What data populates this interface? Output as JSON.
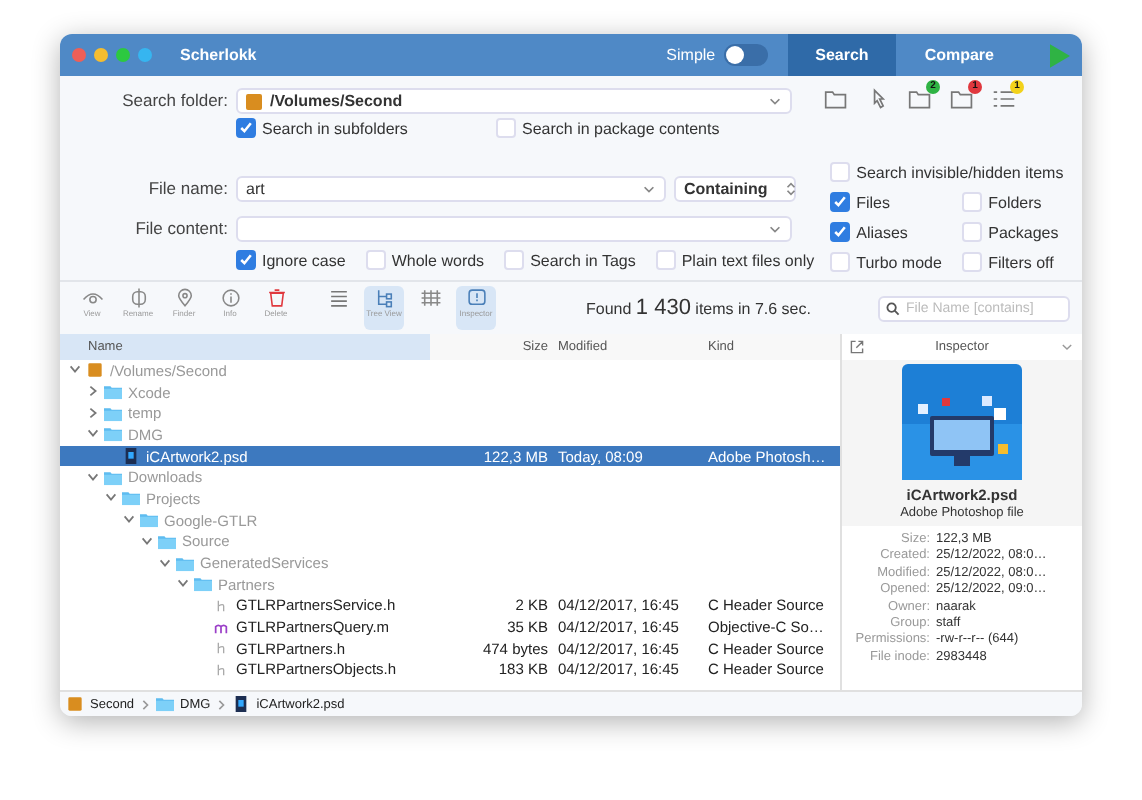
{
  "window": {
    "title": "Scherlokk"
  },
  "mode_toggle": {
    "label": "Simple",
    "on": false
  },
  "tabs": [
    {
      "label": "Search",
      "selected": true
    },
    {
      "label": "Compare",
      "selected": false
    }
  ],
  "folder_badges": [
    {
      "count": "2",
      "color": "#2fb344"
    },
    {
      "count": "1",
      "color": "#e0383e"
    },
    {
      "count": "1",
      "color": "#f2d21b"
    }
  ],
  "search_folder": {
    "label": "Search folder:",
    "value": "/Volumes/Second"
  },
  "folder_options": [
    {
      "label": "Search in subfolders",
      "checked": true
    },
    {
      "label": "Search in package contents",
      "checked": false
    }
  ],
  "file_name": {
    "label": "File name:",
    "value": "art",
    "match": "Containing"
  },
  "file_content": {
    "label": "File content:"
  },
  "content_options": [
    {
      "label": "Ignore case",
      "checked": true
    },
    {
      "label": "Whole words",
      "checked": false
    },
    {
      "label": "Search in Tags",
      "checked": false
    },
    {
      "label": "Plain text files only",
      "checked": false
    }
  ],
  "hidden_option": {
    "label": "Search invisible/hidden items",
    "checked": false
  },
  "filter_options": [
    {
      "label": "Files",
      "checked": true
    },
    {
      "label": "Folders",
      "checked": false
    },
    {
      "label": "Aliases",
      "checked": true
    },
    {
      "label": "Packages",
      "checked": false
    },
    {
      "label": "Turbo mode",
      "checked": false
    },
    {
      "label": "Filters off",
      "checked": false
    }
  ],
  "toolbar": [
    {
      "kind": "view",
      "label": "View",
      "selected": false
    },
    {
      "kind": "rename",
      "label": "Rename",
      "selected": false
    },
    {
      "kind": "finder",
      "label": "Finder",
      "selected": false
    },
    {
      "kind": "info",
      "label": "Info",
      "selected": false
    },
    {
      "kind": "delete",
      "label": "Delete",
      "selected": false
    },
    {
      "kind": "list",
      "selected": false
    },
    {
      "kind": "tree",
      "label": "Tree View",
      "selected": true
    },
    {
      "kind": "grid",
      "selected": false
    },
    {
      "kind": "inspector",
      "label": "Inspector",
      "selected": true
    }
  ],
  "result": {
    "prefix": "Found",
    "count": "1 430",
    "suffix": "items in 7.6 sec."
  },
  "filter_field": {
    "placeholder": "File Name [contains]"
  },
  "table": {
    "columns": [
      "Name",
      "Size",
      "Modified",
      "Kind"
    ],
    "rows": [
      {
        "kind": "volume",
        "name": "/Volumes/Second",
        "expanded": true,
        "children": [
          {
            "kind": "folder",
            "name": "Xcode",
            "expanded": false
          },
          {
            "kind": "folder",
            "name": "temp",
            "expanded": false
          },
          {
            "kind": "folder",
            "name": "DMG",
            "expanded": true,
            "children": [
              {
                "kind": "psd",
                "name": "iCArtwork2.psd",
                "size": "122,3 MB",
                "modified": "Today, 08:09",
                "file_type": "Adobe Photosh…",
                "selected": true
              }
            ]
          },
          {
            "kind": "folder",
            "name": "Downloads",
            "expanded": true,
            "children": [
              {
                "kind": "folder",
                "name": "Projects",
                "expanded": true,
                "children": [
                  {
                    "kind": "folder",
                    "name": "Google-GTLR",
                    "expanded": true,
                    "children": [
                      {
                        "kind": "folder",
                        "name": "Source",
                        "expanded": true,
                        "children": [
                          {
                            "kind": "folder",
                            "name": "GeneratedServices",
                            "expanded": true,
                            "children": [
                              {
                                "kind": "folder",
                                "name": "Partners",
                                "expanded": true,
                                "children": [
                                  {
                                    "kind": "h",
                                    "name": "GTLRPartnersService.h",
                                    "size": "2 KB",
                                    "modified": "04/12/2017, 16:45",
                                    "file_type": "C Header Source",
                                    "selected": false
                                  },
                                  {
                                    "kind": "m",
                                    "name": "GTLRPartnersQuery.m",
                                    "size": "35 KB",
                                    "modified": "04/12/2017, 16:45",
                                    "file_type": "Objective-C So…",
                                    "selected": false
                                  },
                                  {
                                    "kind": "h",
                                    "name": "GTLRPartners.h",
                                    "size": "474 bytes",
                                    "modified": "04/12/2017, 16:45",
                                    "file_type": "C Header Source",
                                    "selected": false
                                  },
                                  {
                                    "kind": "h",
                                    "name": "GTLRPartnersObjects.h",
                                    "size": "183 KB",
                                    "modified": "04/12/2017, 16:45",
                                    "file_type": "C Header Source",
                                    "selected": false
                                  }
                                ]
                              }
                            ]
                          }
                        ]
                      }
                    ]
                  }
                ]
              }
            ]
          }
        ]
      }
    ]
  },
  "inspector": {
    "title": "Inspector",
    "file_name": "iCArtwork2.psd",
    "file_kind": "Adobe Photoshop file",
    "fields": [
      {
        "label": "Size:",
        "value": "122,3 MB"
      },
      {
        "label": "Created:",
        "value": "25/12/2022, 08:0…"
      },
      {
        "label": "Modified:",
        "value": "25/12/2022, 08:0…"
      },
      {
        "label": "Opened:",
        "value": "25/12/2022, 09:0…"
      },
      {
        "label": "Owner:",
        "value": "naarak"
      },
      {
        "label": "Group:",
        "value": "staff"
      },
      {
        "label": "Permissions:",
        "value": "-rw-r--r-- (644)"
      },
      {
        "label": "File inode:",
        "value": "2983448"
      }
    ]
  },
  "path_bar": [
    {
      "kind": "volume",
      "name": "Second"
    },
    {
      "kind": "folder",
      "name": "DMG"
    },
    {
      "kind": "psd",
      "name": "iCArtwork2.psd"
    }
  ]
}
